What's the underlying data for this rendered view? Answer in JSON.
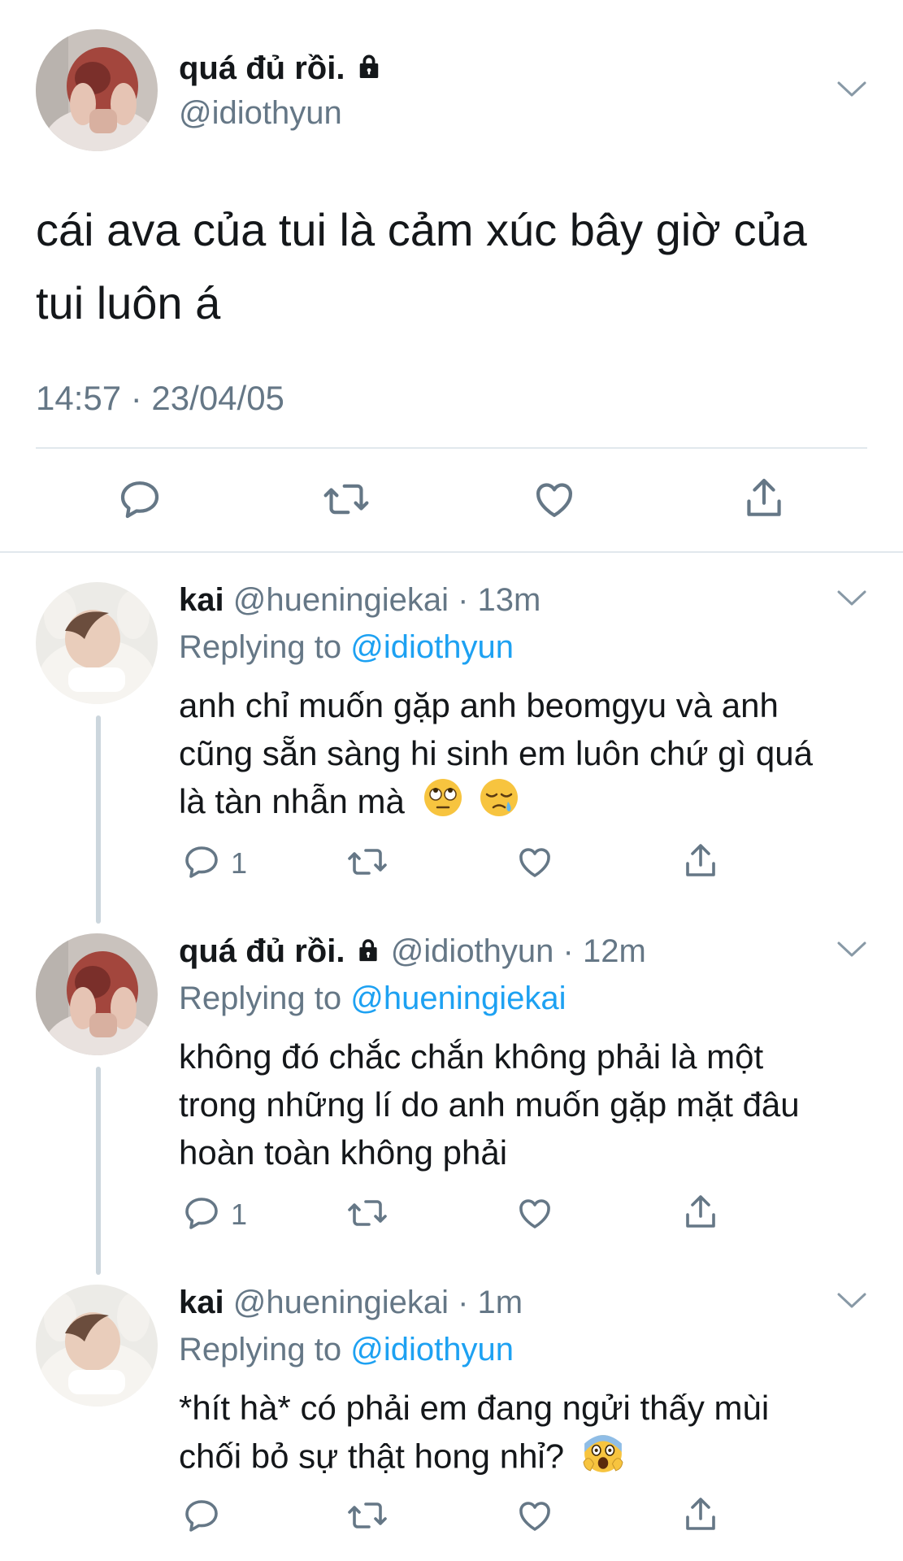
{
  "main_tweet": {
    "display_name": "quá đủ rồi.",
    "handle": "@idiothyun",
    "text_line1": "cái ava của tui là cảm xúc bây giờ của",
    "text_line2": "tui luôn á",
    "timestamp": "14:57 · 23/04/05"
  },
  "replies": [
    {
      "display_name": "kai",
      "handle": "@hueningiekai",
      "time": "· 13m",
      "replying_label": "Replying to",
      "replying_to": "@idiothyun",
      "lines": [
        "anh chỉ muốn gặp anh beomgyu và anh",
        "cũng sẵn sàng hi sinh em luôn chứ gì quá",
        "là tàn nhẫn mà"
      ],
      "reply_count": "1",
      "emojis": [
        "face-with-rolling-eyes",
        "sleepy-face"
      ]
    },
    {
      "display_name": "quá đủ rồi.",
      "handle": "@idiothyun",
      "time": "· 12m",
      "replying_label": "Replying to",
      "replying_to": "@hueningiekai",
      "lines": [
        "không đó chắc chắn không phải là một",
        "trong những lí do anh muốn gặp mặt đâu",
        "hoàn toàn không phải"
      ],
      "reply_count": "1"
    },
    {
      "display_name": "kai",
      "handle": "@hueningiekai",
      "time": "· 1m",
      "replying_label": "Replying to",
      "replying_to": "@idiothyun",
      "lines": [
        "*hít hà* có phải em đang ngửi thấy mùi",
        "chối bỏ sự thật hong nhỉ?"
      ],
      "reply_count": "",
      "emojis": [
        "face-screaming-in-fear"
      ]
    }
  ],
  "colors": {
    "text": "#14171a",
    "secondary": "#657786",
    "link": "#1da1f2",
    "divider": "#e1e8ed",
    "thread_line": "#ccd6dd"
  }
}
